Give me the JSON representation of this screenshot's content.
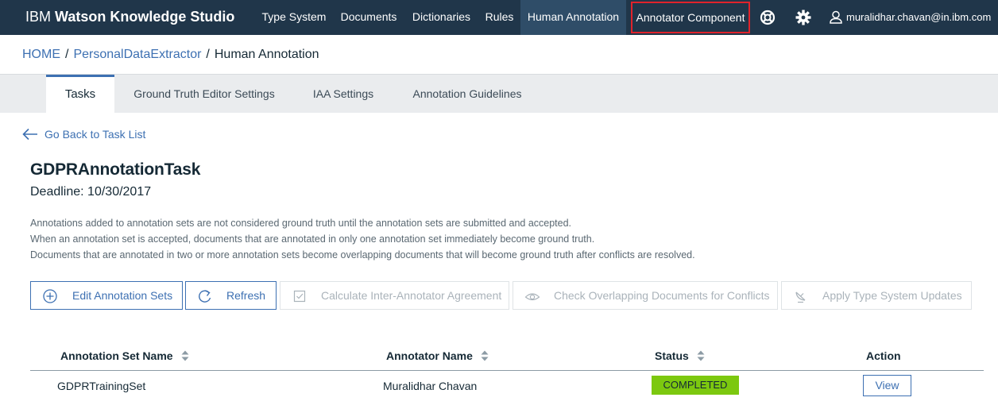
{
  "header": {
    "brand_prefix": "IBM ",
    "brand_name": "Watson Knowledge Studio",
    "nav": [
      {
        "label": "Type System"
      },
      {
        "label": "Documents"
      },
      {
        "label": "Dictionaries"
      },
      {
        "label": "Rules"
      },
      {
        "label": "Human Annotation"
      },
      {
        "label": "Annotator Component"
      }
    ],
    "help_icon": "lifebuoy-icon",
    "settings_icon": "gear-icon",
    "user_icon": "user-icon",
    "user_email": "muralidhar.chavan@in.ibm.com",
    "highlight_color": "#e0232b"
  },
  "breadcrumb": {
    "home": "HOME",
    "project": "PersonalDataExtractor",
    "current": "Human Annotation",
    "separator": "/"
  },
  "tabs": [
    {
      "label": "Tasks"
    },
    {
      "label": "Ground Truth Editor Settings"
    },
    {
      "label": "IAA Settings"
    },
    {
      "label": "Annotation Guidelines"
    }
  ],
  "back_link": "Go Back to Task List",
  "task": {
    "title": "GDPRAnnotationTask",
    "deadline": "Deadline: 10/30/2017"
  },
  "description": [
    "Annotations added to annotation sets are not considered ground truth until the annotation sets are submitted and accepted.",
    "When an annotation set is accepted, documents that are annotated in only one annotation set immediately become ground truth.",
    "Documents that are annotated in two or more annotation sets become overlapping documents that will become ground truth after conflicts are resolved."
  ],
  "actions": {
    "edit_sets": "Edit Annotation Sets",
    "refresh": "Refresh",
    "calc_iaa": "Calculate Inter-Annotator Agreement",
    "check_overlap": "Check Overlapping Documents for Conflicts",
    "apply_updates": "Apply Type System Updates"
  },
  "table": {
    "headers": {
      "set_name": "Annotation Set Name",
      "annotator": "Annotator Name",
      "status": "Status",
      "action": "Action"
    },
    "rows": [
      {
        "set_name": "GDPRTrainingSet",
        "annotator": "Muralidhar Chavan",
        "status": "COMPLETED",
        "action": "View"
      }
    ],
    "status_color": "#7cc80f"
  }
}
